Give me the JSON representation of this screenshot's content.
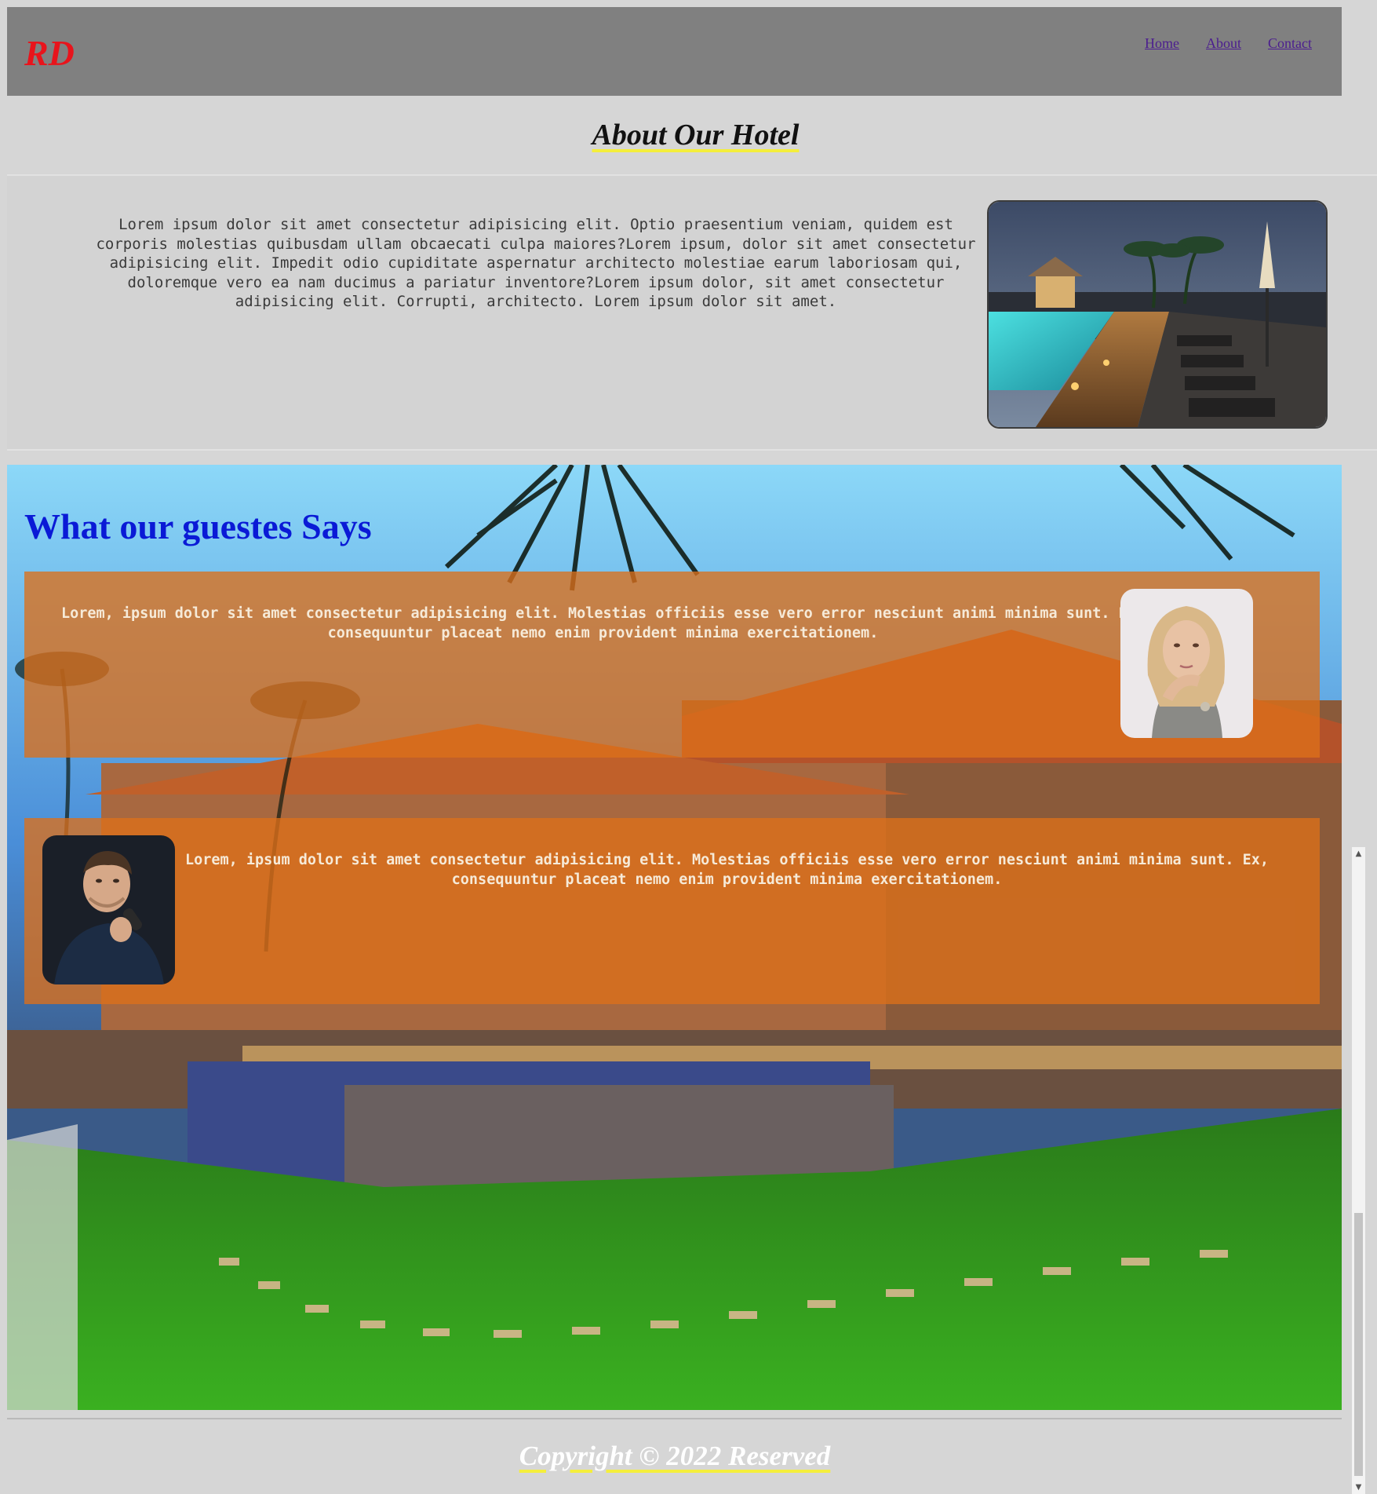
{
  "header": {
    "logo": "RD",
    "nav": [
      {
        "label": "Home"
      },
      {
        "label": "About"
      },
      {
        "label": "Contact"
      }
    ]
  },
  "about": {
    "title": "About Our Hotel",
    "text": "Lorem ipsum dolor sit amet consectetur adipisicing elit. Optio praesentium veniam, quidem est corporis molestias quibusdam ullam obcaecati culpa maiores?Lorem ipsum, dolor sit amet consectetur adipisicing elit. Impedit odio cupiditate aspernatur architecto molestiae earum laboriosam qui, doloremque vero ea nam ducimus a pariatur inventore?Lorem ipsum dolor, sit amet consectetur adipisicing elit. Corrupti, architecto. Lorem ipsum dolor sit amet."
  },
  "guests": {
    "title": "What our guestes Says",
    "testimonials": [
      {
        "text": "Lorem, ipsum dolor sit amet consectetur adipisicing elit. Molestias officiis esse vero error nesciunt animi minima sunt. Ex, consequuntur placeat nemo enim provident minima exercitationem."
      },
      {
        "text": "Lorem, ipsum dolor sit amet consectetur adipisicing elit. Molestias officiis esse vero error nesciunt animi minima sunt. Ex, consequuntur placeat nemo enim provident minima exercitationem."
      }
    ]
  },
  "footer": {
    "copyright": "Copyright © 2022 Reserved"
  },
  "colors": {
    "header_bg": "#808080",
    "logo": "#e8141c",
    "guests_title": "#0a1ad6",
    "testimonial_bg": "#dc701a",
    "underline": "#f4ee3c"
  }
}
